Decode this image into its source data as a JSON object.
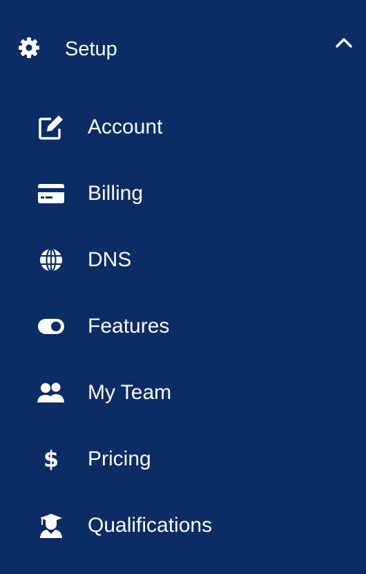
{
  "section": {
    "title": "Setup",
    "icon": "gear-icon",
    "expanded": true
  },
  "menu": {
    "items": [
      {
        "label": "Account",
        "icon": "edit-icon"
      },
      {
        "label": "Billing",
        "icon": "credit-card-icon"
      },
      {
        "label": "DNS",
        "icon": "globe-icon"
      },
      {
        "label": "Features",
        "icon": "toggle-icon"
      },
      {
        "label": "My Team",
        "icon": "users-icon"
      },
      {
        "label": "Pricing",
        "icon": "dollar-icon"
      },
      {
        "label": "Qualifications",
        "icon": "graduate-icon"
      }
    ]
  },
  "colors": {
    "background": "#0b2d63",
    "text": "#ffffff"
  }
}
